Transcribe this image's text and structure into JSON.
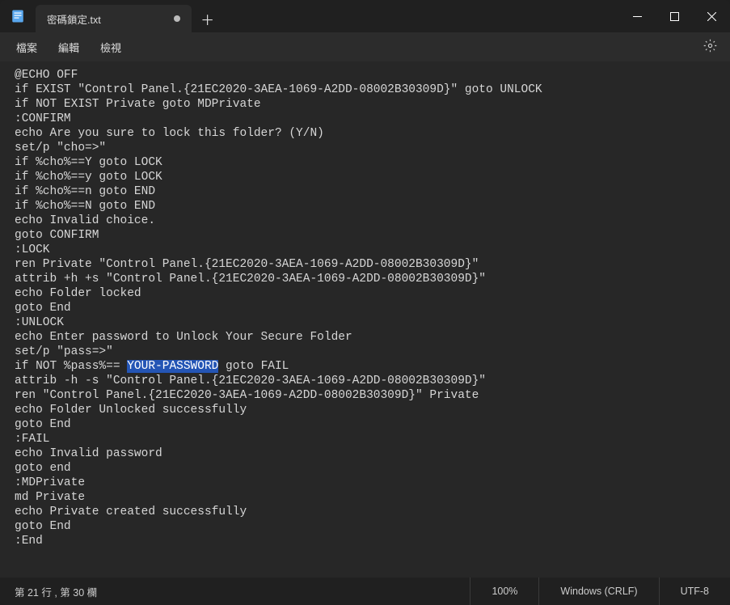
{
  "tab": {
    "title": "密碼鎖定.txt"
  },
  "menu": {
    "file": "檔案",
    "edit": "編輯",
    "view": "檢視"
  },
  "code": {
    "lines": [
      "@ECHO OFF",
      "if EXIST \"Control Panel.{21EC2020-3AEA-1069-A2DD-08002B30309D}\" goto UNLOCK",
      "if NOT EXIST Private goto MDPrivate",
      ":CONFIRM",
      "echo Are you sure to lock this folder? (Y/N)",
      "set/p \"cho=>\"",
      "if %cho%==Y goto LOCK",
      "if %cho%==y goto LOCK",
      "if %cho%==n goto END",
      "if %cho%==N goto END",
      "echo Invalid choice.",
      "goto CONFIRM",
      ":LOCK",
      "ren Private \"Control Panel.{21EC2020-3AEA-1069-A2DD-08002B30309D}\"",
      "attrib +h +s \"Control Panel.{21EC2020-3AEA-1069-A2DD-08002B30309D}\"",
      "echo Folder locked",
      "goto End",
      ":UNLOCK",
      "echo Enter password to Unlock Your Secure Folder",
      "set/p \"pass=>\""
    ],
    "line21_pre": "if NOT %pass%== ",
    "line21_sel": "YOUR-PASSWORD",
    "line21_post": " goto FAIL",
    "lines_after": [
      "attrib -h -s \"Control Panel.{21EC2020-3AEA-1069-A2DD-08002B30309D}\"",
      "ren \"Control Panel.{21EC2020-3AEA-1069-A2DD-08002B30309D}\" Private",
      "echo Folder Unlocked successfully",
      "goto End",
      ":FAIL",
      "echo Invalid password",
      "goto end",
      ":MDPrivate",
      "md Private",
      "echo Private created successfully",
      "goto End",
      ":End"
    ]
  },
  "status": {
    "position": "第 21 行 , 第 30 欄",
    "zoom": "100%",
    "eol": "Windows (CRLF)",
    "encoding": "UTF-8"
  }
}
